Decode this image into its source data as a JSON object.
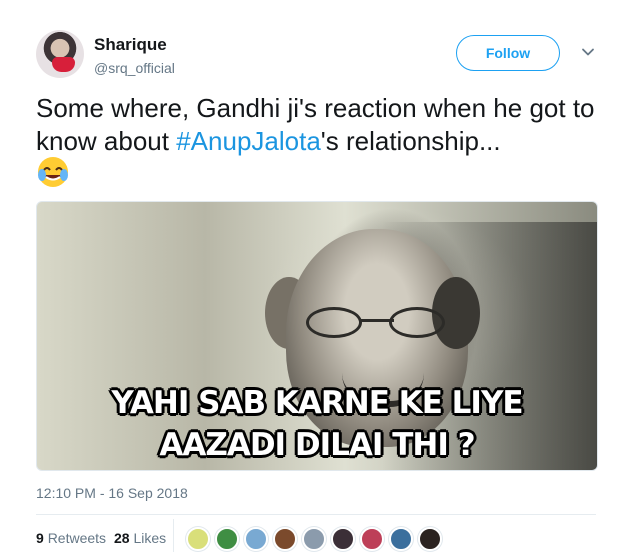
{
  "author": {
    "display_name": "Sharique",
    "handle": "@srq_official",
    "avatar_icon": "profile-photo-icon"
  },
  "actions": {
    "follow_label": "Follow",
    "more_icon": "chevron-down-icon"
  },
  "tweet": {
    "text_before": "Some where, Gandhi ji's reaction when he got to know about ",
    "hashtag": "#AnupJalota",
    "text_after": "'s relationship...",
    "emoji": "😂",
    "timestamp": "12:10 PM - 16 Sep 2018"
  },
  "media": {
    "overlay_line_1": "YAHI SAB KARNE KE LIYE",
    "overlay_line_2": "AAZADI DILAI THI ?"
  },
  "stats": {
    "retweets_count": "9",
    "retweets_label": "Retweets",
    "likes_count": "28",
    "likes_label": "Likes"
  },
  "liker_avatars": [
    {
      "name": "liker-avatar-1",
      "color": "#d9df7a"
    },
    {
      "name": "liker-avatar-2",
      "color": "#3f8e43"
    },
    {
      "name": "liker-avatar-3",
      "color": "#79a9d2"
    },
    {
      "name": "liker-avatar-4",
      "color": "#7b4a2c"
    },
    {
      "name": "liker-avatar-5",
      "color": "#8b9bac"
    },
    {
      "name": "liker-avatar-6",
      "color": "#3b2f37"
    },
    {
      "name": "liker-avatar-7",
      "color": "#bd3f58"
    },
    {
      "name": "liker-avatar-8",
      "color": "#3b6f9d"
    },
    {
      "name": "liker-avatar-9",
      "color": "#2b2320"
    }
  ],
  "colors": {
    "link_blue": "#1b95e0",
    "follow_blue": "#1da1f2",
    "muted_text": "#657786",
    "primary_text": "#14171a",
    "border": "#e6ecf0"
  }
}
